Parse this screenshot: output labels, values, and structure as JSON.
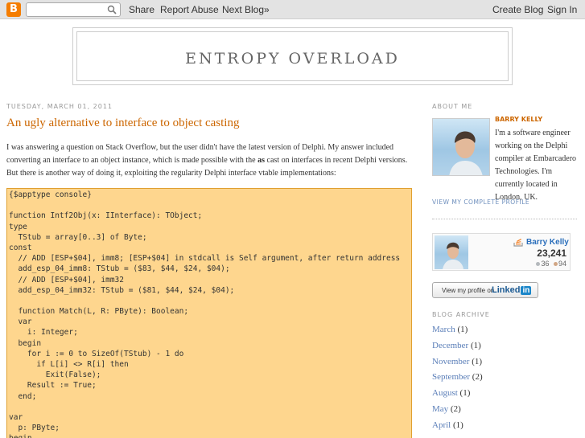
{
  "navbar": {
    "logo_letter": "B",
    "search_placeholder": "",
    "share": "Share",
    "report_abuse": "Report Abuse",
    "next_blog": "Next Blog»",
    "create_blog": "Create Blog",
    "sign_in": "Sign In"
  },
  "header": {
    "title": "ENTROPY OVERLOAD"
  },
  "post": {
    "date": "TUESDAY, MARCH 01, 2011",
    "title": "An ugly alternative to interface to object casting",
    "body_part1": "I was answering a question on Stack Overflow, but the user didn't have the latest version of Delphi. My answer included converting an interface to an object instance, which is made possible with the ",
    "body_bold": "as",
    "body_part2": " cast on interfaces in recent Delphi versions. But there is another way of doing it, exploiting the regularity Delphi interface vtable implementations:",
    "code_lines": [
      "{$apptype console}",
      "",
      "function Intf2Obj(x: IInterface): TObject;",
      "type",
      "  TStub = array[0..3] of Byte;",
      "const",
      "  // ADD [ESP+$04], imm8; [ESP+$04] in stdcall is Self argument, after return address",
      "  add_esp_04_imm8: TStub = ($83, $44, $24, $04);",
      "  // ADD [ESP+$04], imm32",
      "  add_esp_04_imm32: TStub = ($81, $44, $24, $04);",
      "",
      "  function Match(L, R: PByte): Boolean;",
      "  var",
      "    i: Integer;",
      "  begin",
      "    for i := 0 to SizeOf(TStub) - 1 do",
      "      if L[i] <> R[i] then",
      "        Exit(False);",
      "    Result := True;",
      "  end;",
      "",
      "var",
      "  p: PByte;",
      "begin"
    ]
  },
  "sidebar": {
    "about_heading": "ABOUT ME",
    "profile_name": "BARRY KELLY",
    "profile_text": "I'm a software engineer working on the Delphi compiler at Embarcadero Technologies. I'm currently located in London, UK.",
    "profile_link": "VIEW MY COMPLETE PROFILE",
    "so_badge": {
      "name": "Barry Kelly",
      "reputation": "23,241",
      "silver": "36",
      "bronze": "94",
      "silver_color": "#b4b8bc",
      "bronze_color": "#d1a684"
    },
    "linkedin": {
      "text": "View my profile on",
      "logo": "Linked",
      "logo_in": "in"
    },
    "archive_heading": "BLOG ARCHIVE",
    "archive": [
      {
        "month": "March",
        "count": "(1)"
      },
      {
        "month": "December",
        "count": "(1)"
      },
      {
        "month": "November",
        "count": "(1)"
      },
      {
        "month": "September",
        "count": "(2)"
      },
      {
        "month": "August",
        "count": "(1)"
      },
      {
        "month": "May",
        "count": "(2)"
      },
      {
        "month": "April",
        "count": "(1)"
      }
    ]
  },
  "colors": {
    "accent": "#cc6600",
    "link": "#5a7eb8",
    "code_bg": "#fed68e"
  }
}
